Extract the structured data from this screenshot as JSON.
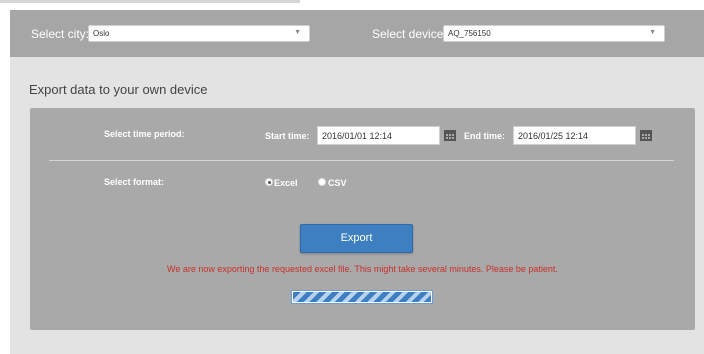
{
  "selectors": {
    "city_label": "Select city:",
    "city_value": "Oslo",
    "device_label": "Select device:",
    "device_value": "AQ_756150"
  },
  "export": {
    "title": "Export data to your own device",
    "time_period_label": "Select time period:",
    "start_label": "Start time:",
    "start_value": "2016/01/01 12:14",
    "end_label": "End time:",
    "end_value": "2016/01/25 12:14",
    "format_label": "Select format:",
    "format_options": [
      "Excel",
      "CSV"
    ],
    "selected_format": "Excel",
    "button_label": "Export",
    "message": "We are now exporting the requested excel file. This might take several minutes. Please be patient.",
    "progress": 1.0
  },
  "colors": {
    "accent": "#3d7fc1",
    "message": "#c9302c",
    "panel": "#a9a9a9"
  },
  "icons": [
    "chevron-down-icon",
    "calendar-icon"
  ]
}
